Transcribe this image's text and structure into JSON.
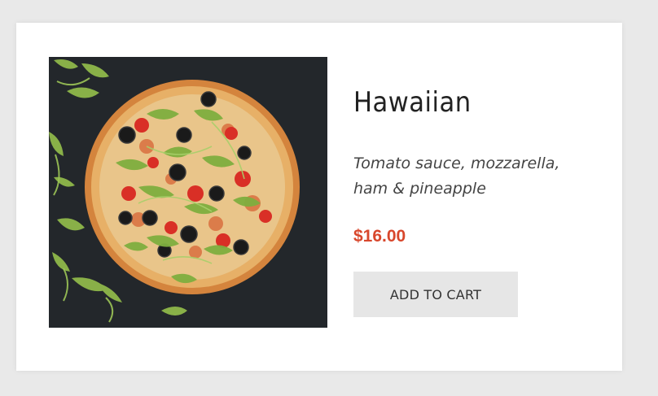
{
  "product": {
    "name": "Hawaiian",
    "description": "Tomato sauce, mozzarella, ham & pineapple",
    "price": "$16.00",
    "add_to_cart_label": "ADD TO CART",
    "image_alt": "pizza-photo"
  },
  "colors": {
    "price": "#d8472c",
    "button_bg": "#e6e6e6",
    "card_bg": "#ffffff",
    "page_bg": "#e9e9e9"
  }
}
